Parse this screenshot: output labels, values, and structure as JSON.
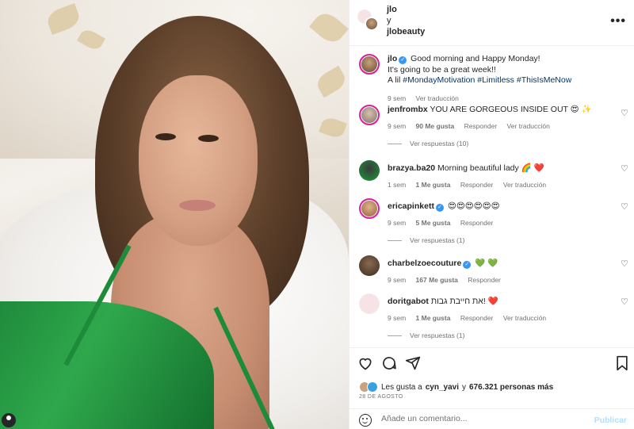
{
  "header": {
    "user1": "jlo",
    "conjunction": "y",
    "user2": "jlobeauty",
    "more_icon": "more-horizontal-icon"
  },
  "caption": {
    "username": "jlo",
    "line1": "Good morning and Happy Monday!",
    "line2": "It's going to be a great week!!",
    "line3_prefix": "A lil",
    "hashtags": [
      "#MondayMotivation",
      "#Limitless",
      "#ThisIsMeNow"
    ],
    "time": "9 sem",
    "translate": "Ver traducción"
  },
  "comments": [
    {
      "username": "jenfrombx",
      "text": "YOU ARE GORGEOUS INSIDE OUT 😍 ✨",
      "time": "9 sem",
      "likes": "90 Me gusta",
      "reply": "Responder",
      "translate": "Ver traducción",
      "replies": "Ver respuestas (10)",
      "verified": false
    },
    {
      "username": "brazya.ba20",
      "text": "Morning beautiful lady 🌈 ❤️",
      "time": "1 sem",
      "likes": "1 Me gusta",
      "reply": "Responder",
      "translate": "Ver traducción",
      "verified": false
    },
    {
      "username": "ericapinkett",
      "text": "😍😍😍😍😍😍",
      "time": "9 sem",
      "likes": "5 Me gusta",
      "reply": "Responder",
      "replies": "Ver respuestas (1)",
      "verified": true
    },
    {
      "username": "charbelzoecouture",
      "text": "💚 💚",
      "time": "9 sem",
      "likes": "167 Me gusta",
      "reply": "Responder",
      "verified": true
    },
    {
      "username": "doritgabot",
      "text": "את חייבת גבות! ❤️",
      "time": "9 sem",
      "likes": "1 Me gusta",
      "reply": "Responder",
      "translate": "Ver traducción",
      "replies": "Ver respuestas (1)",
      "verified": false
    }
  ],
  "actions": {
    "like_icon": "heart-icon",
    "comment_icon": "comment-icon",
    "share_icon": "send-icon",
    "save_icon": "bookmark-icon",
    "likes_prefix": "Les gusta a",
    "likes_user": "cyn_yavi",
    "likes_middle": "y",
    "likes_count": "676.321 personas más",
    "date": "28 DE AGOSTO",
    "add_comment_placeholder": "Añade un comentario...",
    "publish": "Publicar"
  },
  "colors": {
    "link": "#00376b",
    "verified": "#3897f0",
    "publish": "#b2dffc",
    "muted": "#737373",
    "story_ring": "#d6249f"
  }
}
